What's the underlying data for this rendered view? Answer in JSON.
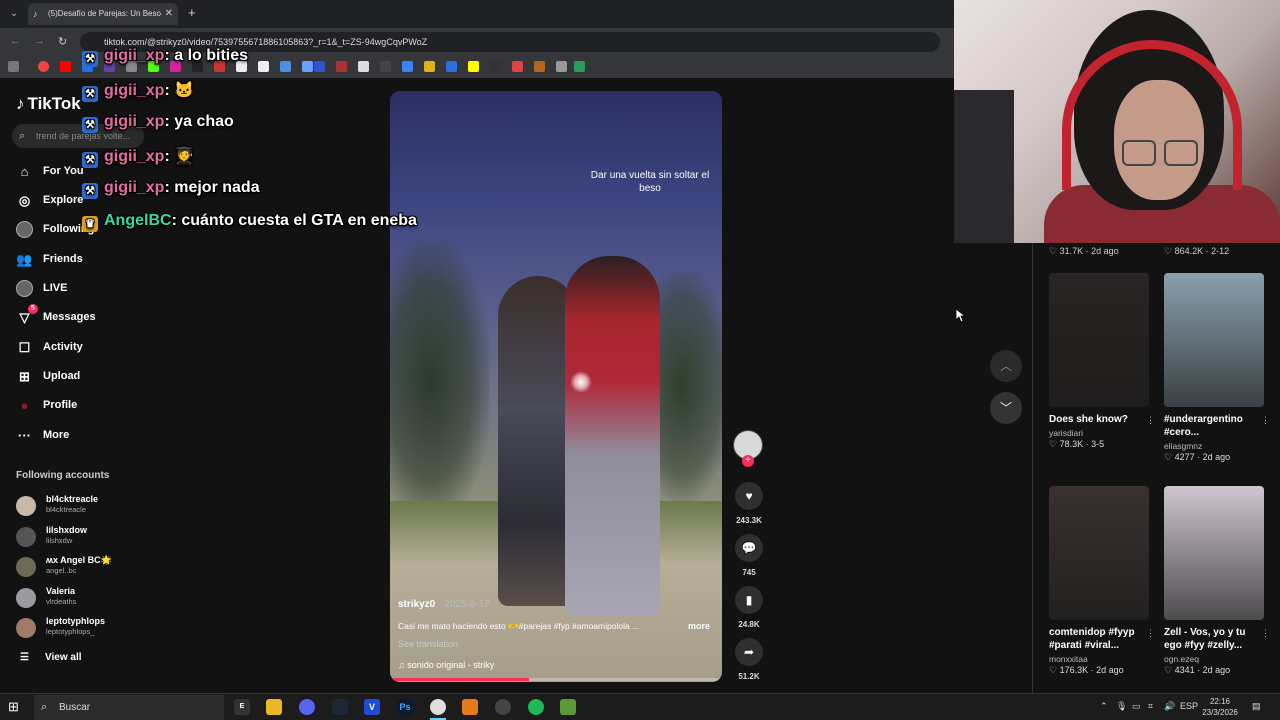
{
  "browser": {
    "tab_title": "(5)Desafío de Parejas: Un Beso",
    "url": "tiktok.com/@strikyz0/video/7539755671886105863?_r=1&_t=ZS-94wgCqvPWoZ"
  },
  "tiktok": {
    "logo": "TikTok",
    "search_placeholder": "trend de parejas volte...",
    "nav": {
      "for_you": "For You",
      "explore": "Explore",
      "following": "Following",
      "friends": "Friends",
      "live": "LIVE",
      "messages": "Messages",
      "messages_badge": "5",
      "activity": "Activity",
      "upload": "Upload",
      "profile": "Profile",
      "more": "More"
    },
    "following_title": "Following accounts",
    "accounts": [
      {
        "name": "bl4cktreacle",
        "handle": "bl4cktreacle"
      },
      {
        "name": "lilshxdow",
        "handle": "lilshxdw"
      },
      {
        "name": "ʍx Angel BC🌟",
        "handle": "angel..bc"
      },
      {
        "name": "Valeria",
        "handle": "vlrdeaths"
      },
      {
        "name": "leptotyphlops",
        "handle": "leptotyphlops_"
      }
    ],
    "view_all": "View all",
    "video": {
      "overlay_text": "Dar una vuelta sin soltar el beso",
      "author": "strikyz0",
      "date": " · 2025-8-17",
      "description": "Casi me mato haciendo esto 🫶#parejas #fyp #amoamipolola ...",
      "more": "more",
      "see_translation": "See translation",
      "sound": "sonido original - striky",
      "progress": 0.42
    },
    "actions": {
      "likes": "243.3K",
      "comments": "745",
      "saves": "24.8K",
      "shares": "51.2K"
    },
    "recommended": {
      "top_stats": [
        "31.7K · 2d ago",
        "864.2K · 2-12"
      ],
      "cards": [
        {
          "title": "Does she know?",
          "author": "yarisdiari",
          "meta": "78.3K · 3-5",
          "color": "#2a2424"
        },
        {
          "title": "#underargentino #cero...",
          "author": "eliasgmnz",
          "meta": "4277 · 2d ago",
          "color": "#8aa0ad"
        },
        {
          "title": "comtenidop #fyyp #parati #viral...",
          "author": "monxxitaa",
          "meta": "176.3K · 2d ago",
          "color": "#3a3030"
        },
        {
          "title": "Zell - Vos, yo y tu ego #fyy #zelly...",
          "author": "ogn.ezeq",
          "meta": "4341 · 2d ago",
          "color": "#cfc6cf"
        }
      ]
    }
  },
  "chat": [
    {
      "user": "gigii_xp",
      "text": ": a lo bities",
      "color": "#e46ea1"
    },
    {
      "user": "gigii_xp",
      "text": ": 🐱",
      "color": "#e46ea1"
    },
    {
      "user": "gigii_xp",
      "text": ": ya chao",
      "color": "#e46ea1"
    },
    {
      "user": "gigii_xp",
      "text": ": 🧑‍🎓",
      "color": "#e46ea1"
    },
    {
      "user": "gigii_xp",
      "text": ": mejor nada",
      "color": "#e46ea1"
    },
    {
      "user": "AngelBC",
      "text": ": cuánto cuesta el GTA en eneba",
      "color": "#3ad6a8"
    }
  ],
  "taskbar": {
    "search": "Buscar",
    "lang": "ESP",
    "time": "22:16",
    "date": "23/3/2026"
  }
}
